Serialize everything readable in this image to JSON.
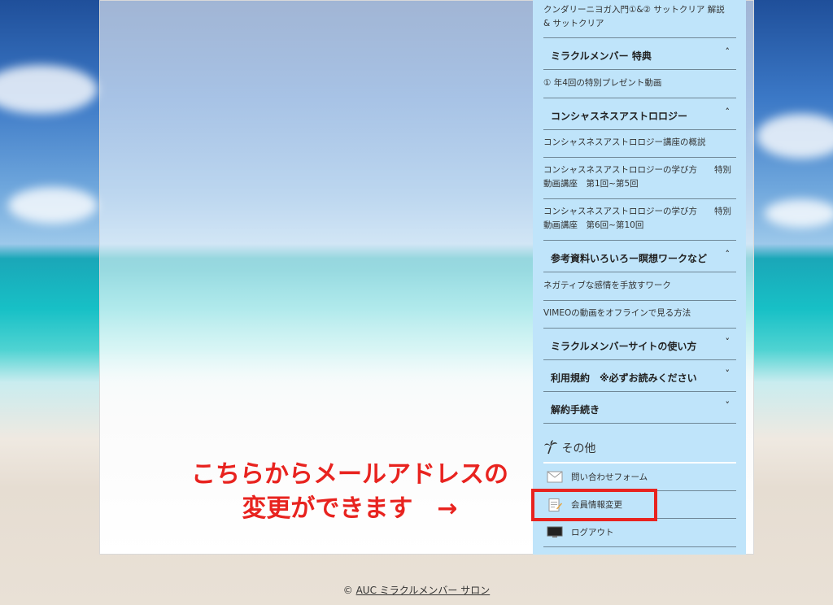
{
  "sidebar": {
    "top_item": "クンダリーニヨガ入門①&② サットクリア 解説 & サットクリア",
    "sections": [
      {
        "title": "ミラクルメンバー 特典",
        "chevron": "up",
        "items": [
          "① 年4回の特別プレゼント動画"
        ]
      },
      {
        "title": "コンシャスネスアストロロジー",
        "chevron": "up",
        "items": [
          "コンシャスネスアストロロジー講座の概説",
          "コンシャスネスアストロロジーの学び方　　特別動画講座　第1回~第5回",
          "コンシャスネスアストロロジーの学び方　　特別動画講座　第6回~第10回"
        ]
      },
      {
        "title": "参考資料いろいろー瞑想ワークなど",
        "chevron": "up",
        "items": [
          "ネガティブな感情を手放すワーク",
          "VIMEOの動画をオフラインで見る方法"
        ]
      },
      {
        "title": "ミラクルメンバーサイトの使い方",
        "chevron": "down",
        "items": []
      },
      {
        "title": "利用規約　※必ずお読みください",
        "chevron": "down",
        "items": []
      },
      {
        "title": "解約手続き",
        "chevron": "down",
        "items": []
      }
    ],
    "other": {
      "title": "その他",
      "links": [
        {
          "label": "問い合わせフォーム",
          "icon": "mail-icon"
        },
        {
          "label": "会員情報変更",
          "icon": "edit-profile-icon"
        },
        {
          "label": "ログアウト",
          "icon": "monitor-icon"
        }
      ]
    }
  },
  "annotation": {
    "line1": "こちらからメールアドレスの",
    "line2": "変更ができます　→"
  },
  "footer": {
    "copyright": "©",
    "site_name": "AUC ミラクルメンバー サロン"
  },
  "colors": {
    "sidebar_bg": "#bfe4fa",
    "annotation": "#e8231f"
  }
}
